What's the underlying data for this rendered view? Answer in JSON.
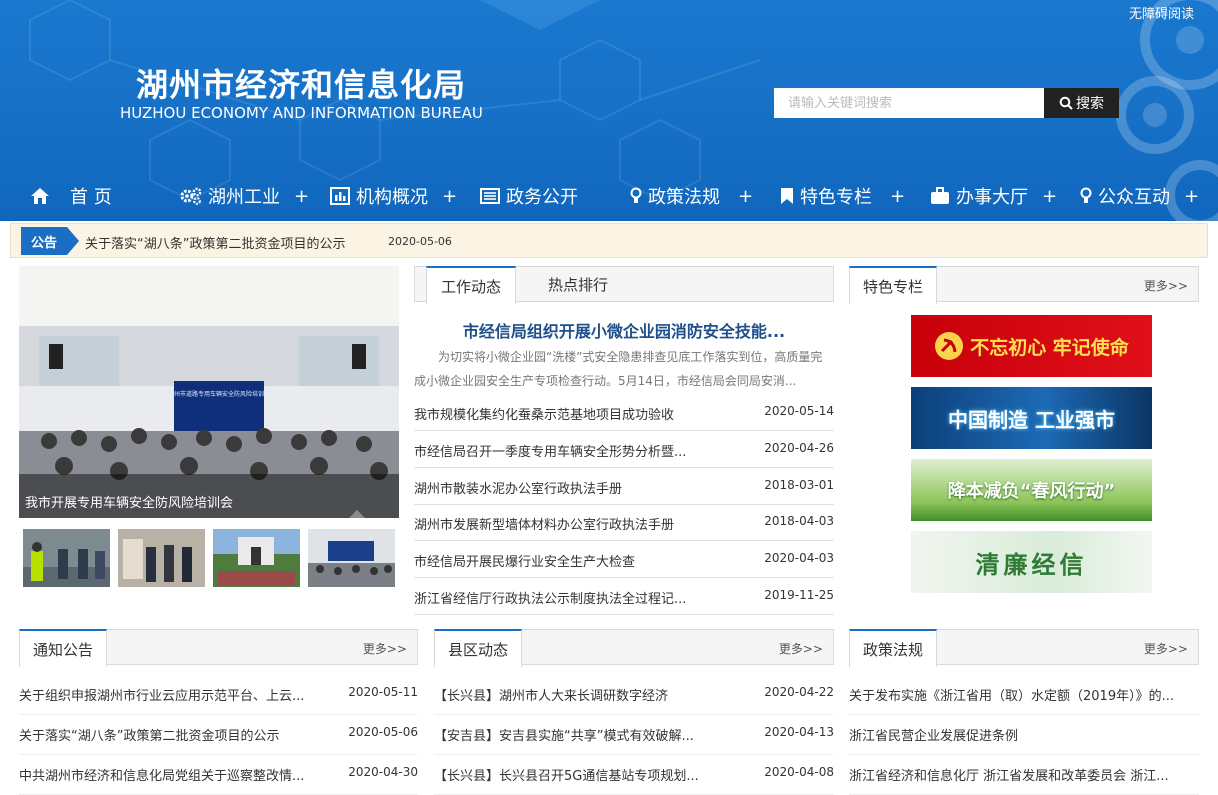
{
  "header": {
    "accessibility": "无障碍阅读",
    "title_cn": "湖州市经济和信息化局",
    "title_en": "HUZHOU ECONOMY AND INFORMATION BUREAU",
    "search_placeholder": "请输入关键词搜索",
    "search_button": "搜索"
  },
  "nav": [
    {
      "label": "首 页",
      "icon": "home-icon",
      "plus": ""
    },
    {
      "label": "湖州工业",
      "icon": "gears-icon",
      "plus": "+"
    },
    {
      "label": "机构概况",
      "icon": "bar-chart-icon",
      "plus": "+"
    },
    {
      "label": "政务公开",
      "icon": "list-icon",
      "plus": ""
    },
    {
      "label": "政策法规",
      "icon": "bulb-icon",
      "plus": "+"
    },
    {
      "label": "特色专栏",
      "icon": "bookmark-icon",
      "plus": "+"
    },
    {
      "label": "办事大厅",
      "icon": "briefcase-icon",
      "plus": "+"
    },
    {
      "label": "公众互动",
      "icon": "bulb-icon",
      "plus": "+"
    }
  ],
  "notice": {
    "tag": "公告",
    "text": "关于落实“湖八条”政策第二批资金项目的公示",
    "date": "2020-05-06"
  },
  "slideshow": {
    "caption": "我市开展专用车辆安全防风险培训会",
    "screen_text": "湖州市道路专用车辆安全防风险培训会"
  },
  "work": {
    "tabs": [
      "工作动态",
      "热点排行"
    ],
    "headline": "市经信局组织开展小微企业园消防安全技能...",
    "summary": "为切实将小微企业园“洗楼”式安全隐患排查见底工作落实到位，高质量完成小微企业园安全生产专项检查行动。5月14日，市经信局会同局安消...",
    "items": [
      {
        "title": "我市规模化集约化蚕桑示范基地项目成功验收",
        "date": "2020-05-14"
      },
      {
        "title": "市经信局召开一季度专用车辆安全形势分析暨...",
        "date": "2020-04-26"
      },
      {
        "title": "湖州市散装水泥办公室行政执法手册",
        "date": "2018-03-01"
      },
      {
        "title": "湖州市发展新型墙体材料办公室行政执法手册",
        "date": "2018-04-03"
      },
      {
        "title": "市经信局开展民爆行业安全生产大检查",
        "date": "2020-04-03"
      },
      {
        "title": "浙江省经信厅行政执法公示制度执法全过程记...",
        "date": "2019-11-25"
      }
    ]
  },
  "featured": {
    "title": "特色专栏",
    "more": "更多>>",
    "banners": [
      "不忘初心 牢记使命",
      "中国制造 工业强市",
      "降本减负“春风行动”",
      "清廉经信"
    ]
  },
  "notices": {
    "title": "通知公告",
    "more": "更多>>",
    "items": [
      {
        "title": "关于组织申报湖州市行业云应用示范平台、上云...",
        "date": "2020-05-11"
      },
      {
        "title": "关于落实“湖八条”政策第二批资金项目的公示",
        "date": "2020-05-06"
      },
      {
        "title": "中共湖州市经济和信息化局党组关于巡察整改情...",
        "date": "2020-04-30"
      }
    ]
  },
  "county": {
    "title": "县区动态",
    "more": "更多>>",
    "items": [
      {
        "title": "【长兴县】湖州市人大来长调研数字经济",
        "date": "2020-04-22"
      },
      {
        "title": "【安吉县】安吉县实施“共享”模式有效破解...",
        "date": "2020-04-13"
      },
      {
        "title": "【长兴县】长兴县召开5G通信基站专项规划...",
        "date": "2020-04-08"
      }
    ]
  },
  "policy": {
    "title": "政策法规",
    "more": "更多>>",
    "items": [
      {
        "title": "关于发布实施《浙江省用（取）水定额（2019年）》的..."
      },
      {
        "title": "浙江省民营企业发展促进条例"
      },
      {
        "title": "浙江省经济和信息化厅 浙江省发展和改革委员会 浙江..."
      }
    ]
  },
  "colors": {
    "primary": "#1a6fc4",
    "header": "#1670c6",
    "headline": "#1e4f8a"
  }
}
